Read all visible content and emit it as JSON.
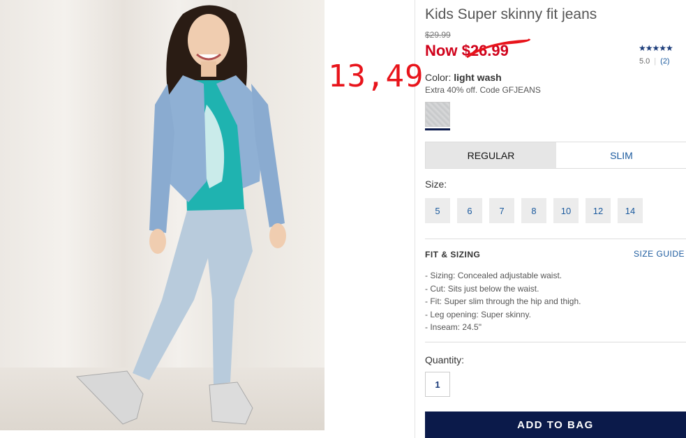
{
  "product": {
    "title": "Kids Super skinny fit jeans",
    "old_price": "$29.99",
    "now_label": "Now",
    "now_price": "$26.99",
    "annotation": "13,49"
  },
  "rating": {
    "stars": "★★★★★",
    "score": "5.0",
    "count": "(2)"
  },
  "color": {
    "label": "Color:",
    "value": "light wash",
    "promo": "Extra 40% off. Code GFJEANS"
  },
  "fit_tabs": [
    {
      "label": "REGULAR",
      "selected": true
    },
    {
      "label": "SLIM",
      "selected": false
    }
  ],
  "size": {
    "label": "Size:",
    "options": [
      "5",
      "6",
      "7",
      "8",
      "10",
      "12",
      "14"
    ]
  },
  "fit_sizing": {
    "heading": "FIT & SIZING",
    "guide_link": "SIZE GUIDE",
    "items": [
      {
        "key": "Sizing:",
        "text": " Concealed adjustable waist."
      },
      {
        "key": "Cut:",
        "text": " Sits just below the waist."
      },
      {
        "key": "Fit:",
        "text": " Super slim through the hip and thigh."
      },
      {
        "key": "Leg opening:",
        "text": " Super skinny."
      },
      {
        "key": "Inseam:",
        "text": " 24.5\""
      }
    ]
  },
  "quantity": {
    "label": "Quantity:",
    "value": "1"
  },
  "cta": {
    "add_to_bag": "ADD TO BAG"
  },
  "colors": {
    "brand_navy": "#0b1a4a",
    "link_blue": "#1b5a9e",
    "sale_red": "#d0021b",
    "annotation_red": "#e8141b"
  }
}
